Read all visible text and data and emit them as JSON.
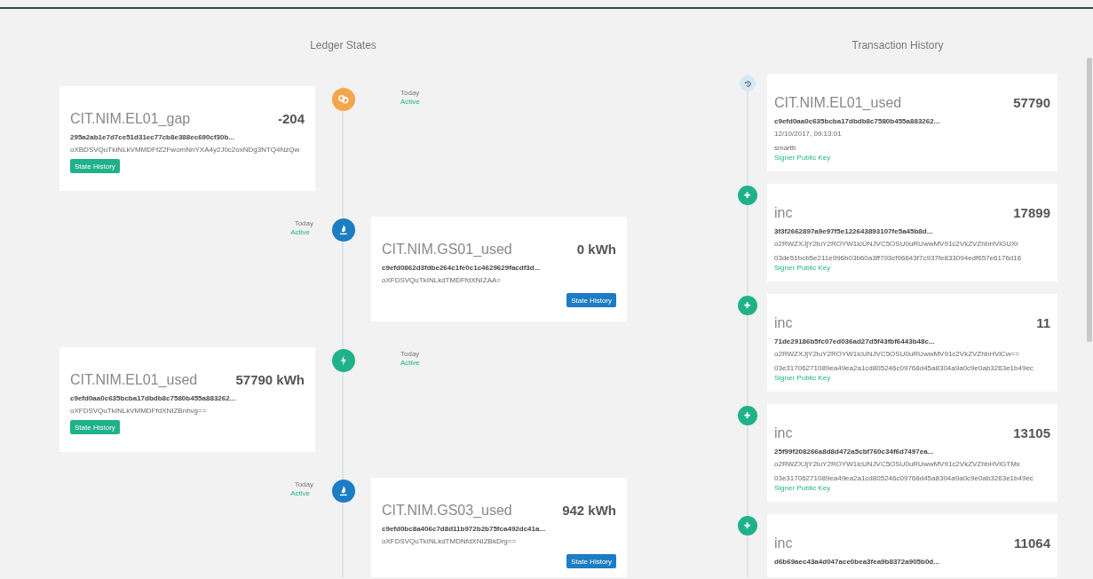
{
  "ledger_states": {
    "title": "Ledger States",
    "entries": [
      {
        "kind": "gap",
        "name": "CIT.NIM.EL01_gap",
        "value": "-204",
        "hash": "295a2ab1e7d7ce51d31ec77cb8e388ec690cf30b...",
        "address": "oXBDSVQuTkINLkVMMDFfZ2FwomNnYXA4y2J0c2oxNDg3NTQ4NzQw",
        "date": "Today",
        "status": "Active",
        "button": "State History"
      },
      {
        "kind": "gas",
        "name": "CIT.NIM.GS01_used",
        "value": "0 kWh",
        "hash": "c9efd0862d3fdbe264c1fe0c1c4629629facdf3d...",
        "address": "oXFDSVQuTkINLkdTMDFfdXNIZAA=",
        "date": "Today",
        "status": "Active",
        "button": "State History"
      },
      {
        "kind": "power",
        "name": "CIT.NIM.EL01_used",
        "value": "57790 kWh",
        "hash": "c9efd0aa0c635bcba17dbdb8c7580b455a883262...",
        "address": "oXFDSVQuTkINLkVMMDFfdXNIZBnhvg==",
        "date": "Today",
        "status": "Active",
        "button": "State History"
      },
      {
        "kind": "gas",
        "name": "CIT.NIM.GS03_used",
        "value": "942 kWh",
        "hash": "c9efd0bc8a406c7d8d11b972b2b75fca492dc41a...",
        "address": "oXFDSVQuTkINLkdTMDNfdXNIZBkDrg==",
        "date": "Today",
        "status": "Active",
        "button": "State History"
      }
    ]
  },
  "transaction_history": {
    "title": "Transaction History",
    "entries": [
      {
        "kind": "history",
        "name": "CIT.NIM.EL01_used",
        "value": "57790",
        "hash": "c9efd0aa0c635bcba17dbdb8c7580b455a883262...",
        "date": "12/10/2017, 09:13:01",
        "signer": "smartb",
        "link": "Signer Public Key"
      },
      {
        "kind": "add",
        "name": "inc",
        "value": "17899",
        "hash": "3f3f2662897a9e97f5e122643893107fe5a45b8d...",
        "payload": "o2RWZXJjY2luY2ROYW1lcUNJVC5OSU0uRUwwMV91c2VkZVZhbHVlGUXr",
        "public_key": "03de51bcb5e211e996b03b60a3ff793cf96643f7c937fe833094edf657e6176d16",
        "link": "Signer Public Key"
      },
      {
        "kind": "add",
        "name": "inc",
        "value": "11",
        "hash": "71de29186b5fc07ed036ad27d5f43fbf6443b48c...",
        "payload": "o2RWZXJjY2luY2ROYW1lcUNJVC5OSU0uRUwwMV91c2VkZVZhbHVlCw==",
        "public_key": "03e31706271089ea49ea2a1cd805246c09768d45a8304a9a0c9e0ab3263e1b49ec",
        "link": "Signer Public Key"
      },
      {
        "kind": "add",
        "name": "inc",
        "value": "13105",
        "hash": "25f99f208266a8d8d472a5cbf760c34f6d7497ea...",
        "payload": "o2RWZXJjY2luY2ROYW1lcUNJVC5OSU0uRUwwMV91c2VkZVZhbHVlGTMx",
        "public_key": "03e31706271089ea49ea2a1cd805246c09768d45a8304a9a0c9e0ab3263e1b49ec",
        "link": "Signer Public Key"
      },
      {
        "kind": "add",
        "name": "inc",
        "value": "11064",
        "hash": "d6b69aec43a4d047ace0bea3fea9b8372a905b0d..."
      }
    ]
  }
}
